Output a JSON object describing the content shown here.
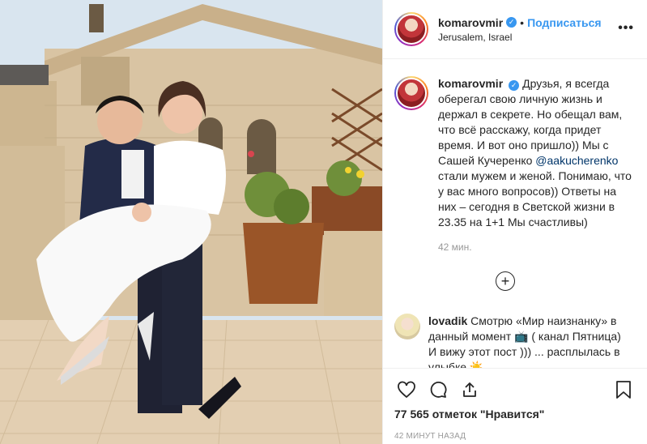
{
  "post": {
    "username": "komarovmir",
    "follow_label": "Подписаться",
    "location": "Jerusalem, Israel",
    "more_label": "•••",
    "verified_mark": "✓",
    "dot": "•"
  },
  "caption": {
    "username": "komarovmir",
    "text_before": "Друзья, я всегда оберегал свою личную жизнь и держал в секрете. Но обещал вам, что всё расскажу, когда придет время. И вот оно пришло)) Мы с Сашей Кучеренко ",
    "mention": "@aakucherenko",
    "text_after": " стали мужем и женой.  Понимаю, что у вас много вопросов)) Ответы на них – сегодня в Светской жизни в 23.35 на 1+1 Мы счастливы)",
    "time": "42 мин."
  },
  "load_more": "+",
  "comment": {
    "username": "lovadik",
    "text": "Смотрю «Мир наизнанку» в данный момент 📺 ( канал Пятница) И вижу этот пост ))) ... расплылась в улыбке ☀️"
  },
  "actions": {
    "likes": "77 565 отметок \"Нравится\"",
    "posted": "42 МИНУТ НАЗАД"
  },
  "icons": [
    "heart-icon",
    "comment-icon",
    "share-icon",
    "bookmark-icon",
    "more-options-icon",
    "add-circle-icon",
    "verified-badge-icon"
  ],
  "colors": {
    "accent": "#3897f0",
    "text": "#262626",
    "muted": "#999999",
    "border": "#efefef"
  }
}
